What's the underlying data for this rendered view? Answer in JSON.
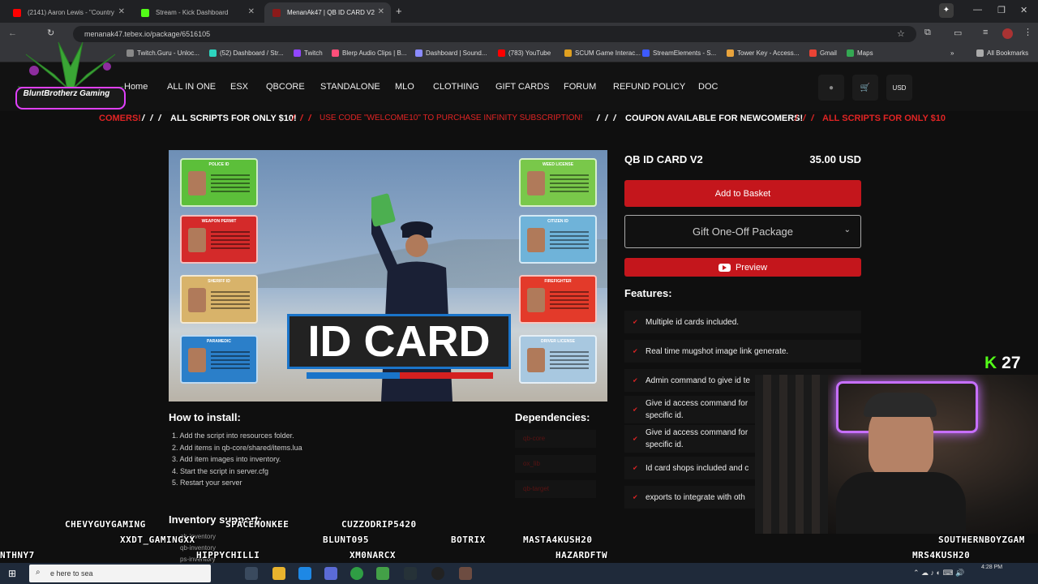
{
  "browser": {
    "tabs": [
      {
        "title": "(2141) Aaron Lewis - \"Country",
        "favicon_color": "#ff0000"
      },
      {
        "title": "Stream - Kick Dashboard",
        "favicon_color": "#53fc18"
      },
      {
        "title": "MenanAk47 | QB ID CARD V2",
        "favicon_color": "#8b1a1a"
      }
    ],
    "new_tab": "+",
    "url": "menanak47.tebex.io/package/6516105",
    "bookmarks": [
      {
        "label": "Twitch.Guru - Unloc...",
        "color": "#888888"
      },
      {
        "label": "(52) Dashboard / Str...",
        "color": "#2dd4bf"
      },
      {
        "label": "Twitch",
        "color": "#9146ff"
      },
      {
        "label": "Blerp Audio Clips | B...",
        "color": "#ff4f7a"
      },
      {
        "label": "Dashboard | Sound...",
        "color": "#8b8bff"
      },
      {
        "label": "(783) YouTube",
        "color": "#ff0000"
      },
      {
        "label": "SCUM Game Interac...",
        "color": "#e0a020"
      },
      {
        "label": "StreamElements - S...",
        "color": "#3d5afe"
      },
      {
        "label": "Tower Key - Access...",
        "color": "#e8a33c"
      },
      {
        "label": "Gmail",
        "color": "#ea4335"
      },
      {
        "label": "Maps",
        "color": "#34a853"
      }
    ],
    "all_bookmarks": "All Bookmarks"
  },
  "site": {
    "brand": "BluntBrotherz Gaming",
    "nav": [
      "Home",
      "ALL IN ONE",
      "ESX",
      "QBCORE",
      "STANDALONE",
      "MLO",
      "CLOTHING",
      "GIFT CARDS",
      "FORUM",
      "REFUND POLICY",
      "DOC"
    ],
    "currency": "USD",
    "ticker": {
      "t1": "COMERS!",
      "t2": "ALL SCRIPTS FOR ONLY $10!",
      "t3": "USE CODE \"WELCOME10\" TO PURCHASE INFINITY SUBSCRIPTION!",
      "t4": "COUPON AVAILABLE FOR NEWCOMERS!",
      "t5": "ALL SCRIPTS FOR ONLY $10"
    },
    "hero": {
      "banner": "ID CARD",
      "cards": [
        {
          "title": "POLICE ID",
          "color": "#5cbf3a"
        },
        {
          "title": "WEAPON PERMIT",
          "color": "#d42a2a"
        },
        {
          "title": "SHERIFF ID",
          "color": "#d8b36a"
        },
        {
          "title": "PARAMEDIC",
          "color": "#2b7fc9"
        },
        {
          "title": "WEED LICENSE",
          "color": "#79c84a"
        },
        {
          "title": "CITIZEN ID",
          "color": "#6fb3d9"
        },
        {
          "title": "FIREFIGHTER",
          "color": "#e33a2a"
        },
        {
          "title": "DRIVER LICENSE",
          "color": "#a8c8e0"
        }
      ]
    },
    "product": {
      "name": "QB ID CARD V2",
      "price": "35.00 USD",
      "add_to_basket": "Add to Basket",
      "gift": "Gift One-Off Package",
      "preview": "Preview",
      "features_heading": "Features:",
      "features": [
        "Multiple id cards included.",
        "Real time mugshot image link generate.",
        "Admin command to give id te",
        "Give id access command for\nspecific id.",
        "Give id access command for\nspecific id.",
        "Id card shops included and c",
        "exports to integrate with oth"
      ]
    },
    "install": {
      "heading": "How to install:",
      "steps": [
        "1. Add the script into resources folder.",
        "2. Add items in qb-core/shared/items.lua",
        "3. Add item images into inventory.",
        "4. Start the script in server.cfg",
        "5. Restart your server"
      ]
    },
    "dependencies": {
      "heading": "Dependencies:",
      "items": [
        "qb-core",
        "ox_lib",
        "qb-target"
      ]
    },
    "inventory": {
      "heading": "Inventory support:",
      "items": [
        "qb-inventory",
        "qb-inventory",
        "ps-inventory"
      ]
    }
  },
  "stream": {
    "viewer_count": "27",
    "viewers": [
      "CHEVYGUYGAMING",
      "SPACEMONKEE",
      "CUZZODRIP5420",
      "XXDT_GAMINGXX",
      "BLUNT095",
      "BOTRIX",
      "MASTA4KUSH20",
      "SOUTHERNBOYZGAM",
      "NTHNY7",
      "HIPPYCHILLI",
      "XM0NARCX",
      "HAZARDFTW",
      "MRS4KUSH20"
    ]
  },
  "taskbar": {
    "search_placeholder": "e here to sea",
    "clock": "4:28 PM"
  }
}
